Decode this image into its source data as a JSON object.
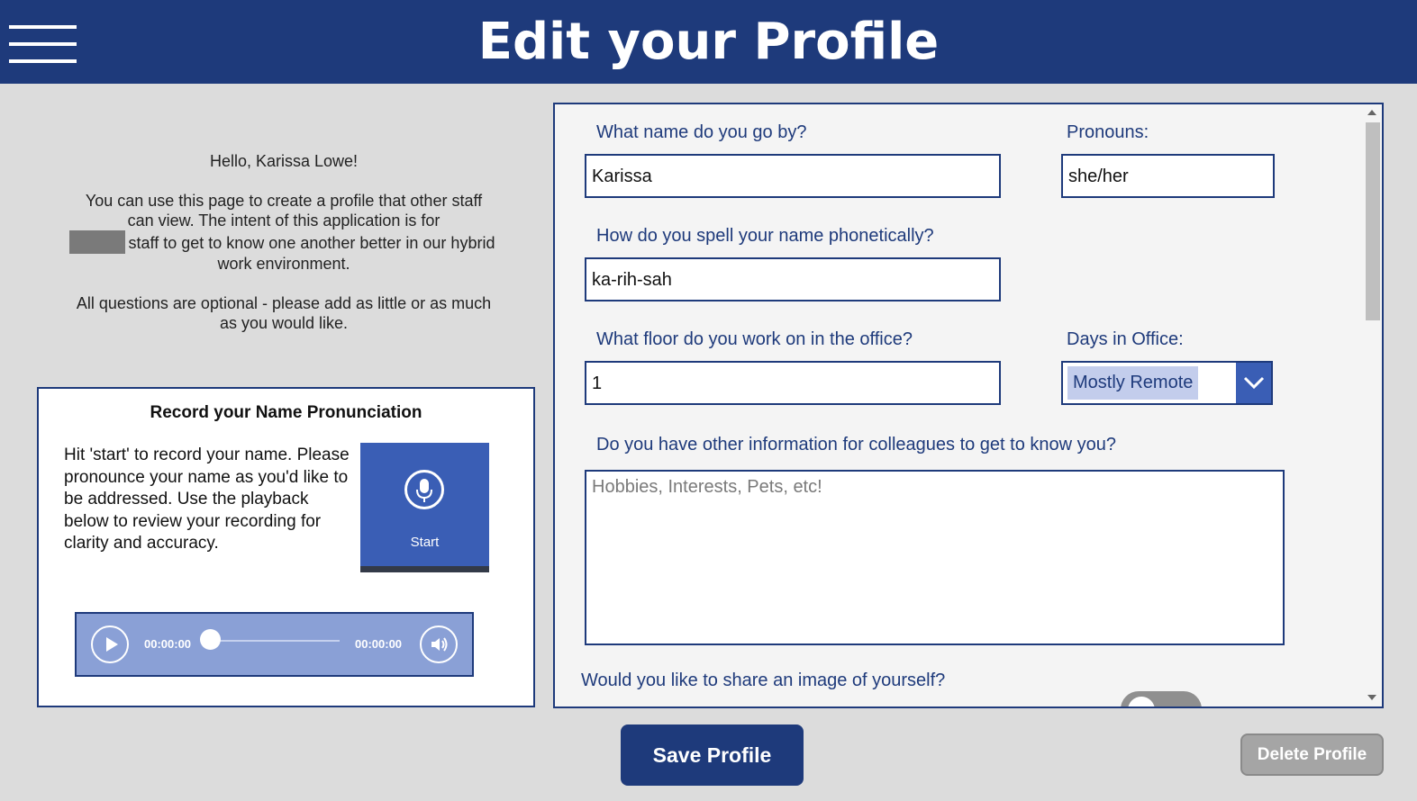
{
  "header": {
    "title": "Edit your Profile",
    "menu_icon": "hamburger-menu-icon"
  },
  "intro": {
    "greeting": "Hello,  Karissa Lowe!",
    "paragraph1_a": "You can use this page to create a profile that other staff can view. The intent of this application is for",
    "paragraph1_b": "staff to get to know one another better in our hybrid work environment.",
    "paragraph2": "All questions are optional - please add as little or as much as you would like."
  },
  "recording": {
    "title": "Record your Name Pronunciation",
    "instructions": "Hit 'start' to record your name. Please pronounce your name as you'd like to be addressed. Use the playback below to review your recording for clarity and accuracy.",
    "start_label": "Start",
    "start_icon": "microphone-icon",
    "player": {
      "current_time": "00:00:00",
      "total_time": "00:00:00",
      "progress": 0
    }
  },
  "form": {
    "name_label": "What name do you go by?",
    "name_value": "Karissa",
    "pronouns_label": "Pronouns:",
    "pronouns_value": "she/her",
    "phonetic_label": "How do you spell your name phonetically?",
    "phonetic_value": "ka-rih-sah",
    "floor_label": "What floor do you work on in the office?",
    "floor_value": "1",
    "days_label": "Days in Office:",
    "days_value": "Mostly Remote",
    "other_label": "Do you have other information for colleagues to get to know you?",
    "other_placeholder": "Hobbies, Interests, Pets, etc!",
    "image_label": "Would you like to share an image of yourself?",
    "image_toggle": false
  },
  "actions": {
    "save_label": "Save Profile",
    "delete_label": "Delete Profile"
  },
  "colors": {
    "brand": "#1e3a7b",
    "accent": "#3a5eb5",
    "player_bg": "#8aa0d6",
    "page_bg": "#dcdcdc"
  }
}
